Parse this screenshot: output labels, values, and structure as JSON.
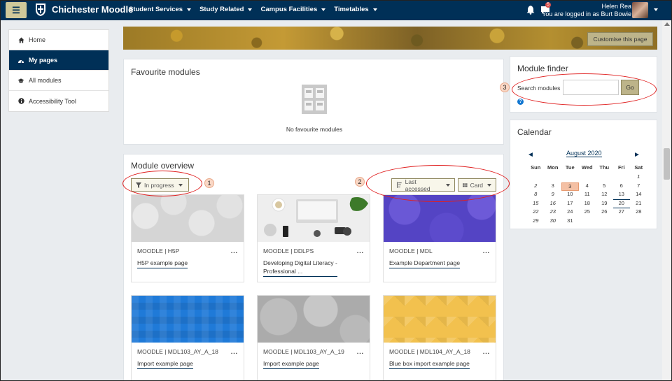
{
  "navbar": {
    "site_name": "Chichester Moodle",
    "menus": [
      "Student Services",
      "Study Related",
      "Campus Facilities",
      "Timetables"
    ],
    "notification_count": "5",
    "user_name": "Helen Rea",
    "user_status": "You are logged in as Burt Bowie"
  },
  "sidebar": {
    "items": [
      {
        "label": "Home",
        "icon": "home-icon"
      },
      {
        "label": "My pages",
        "icon": "dashboard-icon"
      },
      {
        "label": "All modules",
        "icon": "graduation-cap-icon"
      },
      {
        "label": "Accessibility Tool",
        "icon": "info-icon"
      }
    ]
  },
  "header": {
    "customise_label": "Customise this page"
  },
  "favourites": {
    "title": "Favourite modules",
    "empty_text": "No favourite modules"
  },
  "overview": {
    "title": "Module overview",
    "filter_label": "In progress",
    "sort_label": "Last accessed",
    "view_label": "Card",
    "courses": [
      {
        "category": "MOODLE | H5P",
        "name": "H5P example page",
        "name_line2": ""
      },
      {
        "category": "MOODLE | DDLPS",
        "name": "Developing Digital Literacy -",
        "name_line2": "Professional ..."
      },
      {
        "category": "MOODLE | MDL",
        "name": "Example Department page",
        "name_line2": ""
      },
      {
        "category": "MOODLE | MDL103_AY_A_18",
        "name": "Import example page",
        "name_line2": ""
      },
      {
        "category": "MOODLE | MDL103_AY_A_19",
        "name": "Import example page",
        "name_line2": ""
      },
      {
        "category": "MOODLE | MDL104_AY_A_18",
        "name": "Blue box import example page",
        "name_line2": ""
      }
    ],
    "more_label": "..."
  },
  "module_finder": {
    "title": "Module finder",
    "label": "Search modules",
    "value": "",
    "go_label": "Go",
    "help_symbol": "?"
  },
  "calendar": {
    "title": "Calendar",
    "month": "August 2020",
    "prev_symbol": "◄",
    "next_symbol": "►",
    "weekdays": [
      "Sun",
      "Mon",
      "Tue",
      "Wed",
      "Thu",
      "Fri",
      "Sat"
    ],
    "days": [
      "1",
      "2",
      "3",
      "4",
      "5",
      "6",
      "7",
      "8",
      "9",
      "10",
      "11",
      "12",
      "13",
      "14",
      "15",
      "16",
      "17",
      "18",
      "19",
      "20",
      "21",
      "22",
      "23",
      "24",
      "25",
      "26",
      "27",
      "28",
      "29",
      "30",
      "31"
    ],
    "today": "3"
  },
  "annotations": [
    "1",
    "2",
    "3"
  ],
  "colors": {
    "navbar": "#003057",
    "accent": "#bdb48a",
    "annotation": "#e02020"
  }
}
